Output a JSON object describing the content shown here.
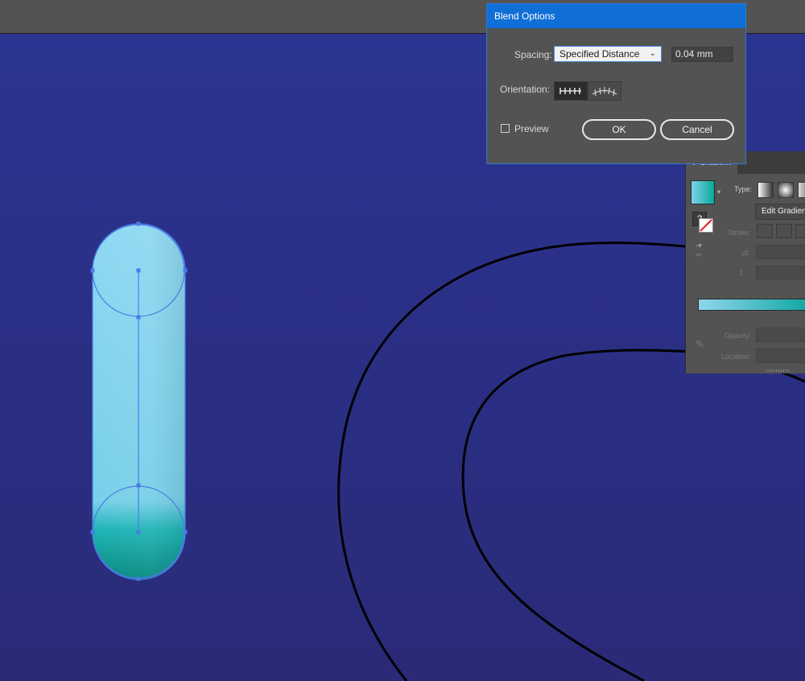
{
  "app": {
    "accent_color": "#0f6fd6",
    "canvas_color": "#2a2f86"
  },
  "blend_dialog": {
    "title": "Blend Options",
    "spacing_label": "Spacing:",
    "spacing_value": "Specified Distance",
    "distance_value": "0.04 mm",
    "orientation_label": "Orientation:",
    "preview_label": "Preview",
    "preview_checked": false,
    "ok_label": "OK",
    "cancel_label": "Cancel"
  },
  "gradient_panel": {
    "tab_label": "Gradient",
    "type_label": "Type:",
    "edit_button_label": "Edit Gradient",
    "stroke_label": "Stroke:",
    "opacity_label": "Opacity:",
    "location_label": "Location:",
    "help_icon_label": "?",
    "start_color": "#8fd6ec",
    "end_color": "#0fa7a3"
  },
  "artwork": {
    "capsule_top_color": "#8fd8f2",
    "capsule_bottom_color": "#0a8f88",
    "selection_color": "#4a7be6"
  }
}
